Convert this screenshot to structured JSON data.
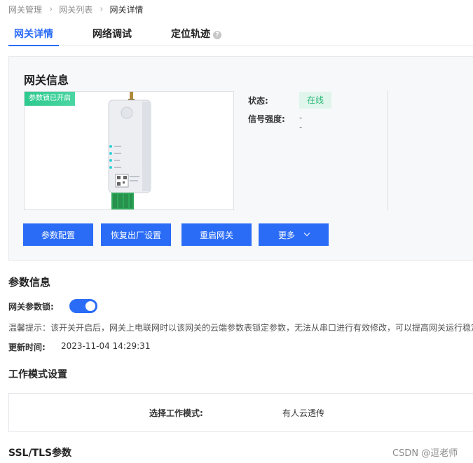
{
  "breadcrumb": {
    "items": [
      "网关管理",
      "网关列表"
    ],
    "current": "网关详情"
  },
  "tabs": [
    {
      "label": "网关详情",
      "active": true
    },
    {
      "label": "网络调试",
      "active": false
    },
    {
      "label": "定位轨迹",
      "active": false,
      "icon": "help-icon"
    }
  ],
  "gateway": {
    "title": "网关信息",
    "lock_badge": "参数锁已开启",
    "device_image": "gateway-device-image",
    "status_label": "状态:",
    "status_value": "在线",
    "signal_label": "信号强度:",
    "signal_value": "--",
    "buttons": {
      "config": "参数配置",
      "reset": "恢复出厂设置",
      "restart": "重启网关",
      "more": "更多"
    }
  },
  "params": {
    "title": "参数信息",
    "lock_label": "网关参数锁:",
    "lock_enabled": true,
    "hint": "温馨提示：该开关开启后，网关上电联网时以该网关的云端参数表锁定参数，无法从串口进行有效修改，可以提高网关运行稳定",
    "update_label": "更新时间:",
    "update_value": "2023-11-04 14:29:31"
  },
  "work_mode": {
    "title": "工作模式设置",
    "label": "选择工作模式:",
    "value": "有人云透传"
  },
  "ssl": {
    "title": "SSL/TLS参数"
  },
  "watermark": "CSDN @逗老师",
  "colors": {
    "primary": "#2b6cf6",
    "online_bg": "#e0f5ec",
    "online_text": "#2fb87a",
    "badge": "#2dc98e"
  }
}
